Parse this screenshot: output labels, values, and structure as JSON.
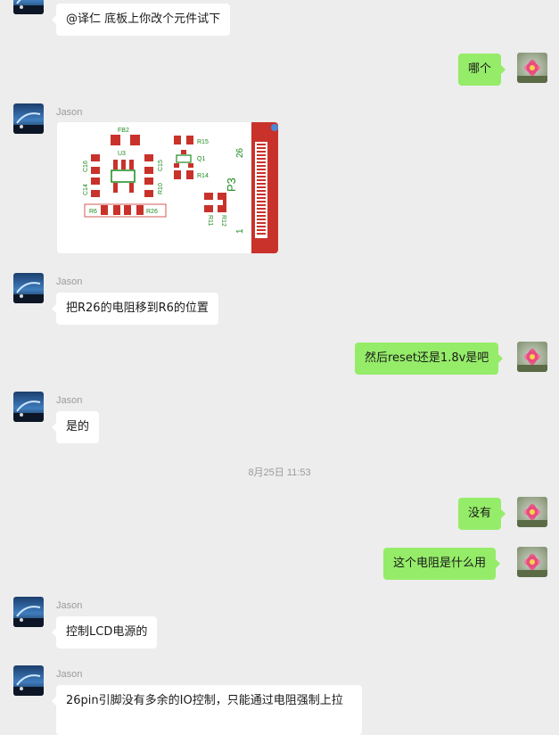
{
  "chat": {
    "messages": [
      {
        "side": "left",
        "sender": "",
        "text": "@译仁   底板上你改个元件试下"
      },
      {
        "side": "right",
        "text": "哪个"
      },
      {
        "side": "left",
        "sender": "Jason",
        "type": "image"
      },
      {
        "side": "left",
        "sender": "Jason",
        "text": "把R26的电阻移到R6的位置"
      },
      {
        "side": "right",
        "text": "然后reset还是1.8v是吧"
      },
      {
        "side": "left",
        "sender": "Jason",
        "text": "是的"
      },
      {
        "side": "right",
        "text": "没有"
      },
      {
        "side": "right",
        "text": "这个电阻是什么用"
      },
      {
        "side": "left",
        "sender": "Jason",
        "text": "控制LCD电源的"
      },
      {
        "side": "left",
        "sender": "Jason",
        "text": "26pin引脚没有多余的IO控制，只能通过电阻强制上拉"
      }
    ],
    "timestamp": "8月25日 11:53"
  },
  "pcb_image": {
    "labels": {
      "fb2": "FB2",
      "u3": "U3",
      "c16": "C16",
      "c14": "C14",
      "c15": "C15",
      "r10": "R10",
      "r15": "R15",
      "q1": "Q1",
      "r14": "R14",
      "r6": "R6",
      "r26": "R26",
      "p3": "P3",
      "pin26": "26",
      "pin1": "1",
      "r11": "R11",
      "r12": "R12"
    },
    "colors": {
      "pad": "#c8322b",
      "silk": "#1e8a1e",
      "outline": "#c8322b"
    }
  },
  "colors": {
    "background": "#ededed",
    "bubble_left": "#ffffff",
    "bubble_right": "#95ec69",
    "name_text": "#9b9b9b"
  },
  "icons": {
    "contact_avatar": "jason-avatar-icon",
    "self_avatar": "lotus-flower-avatar-icon"
  }
}
